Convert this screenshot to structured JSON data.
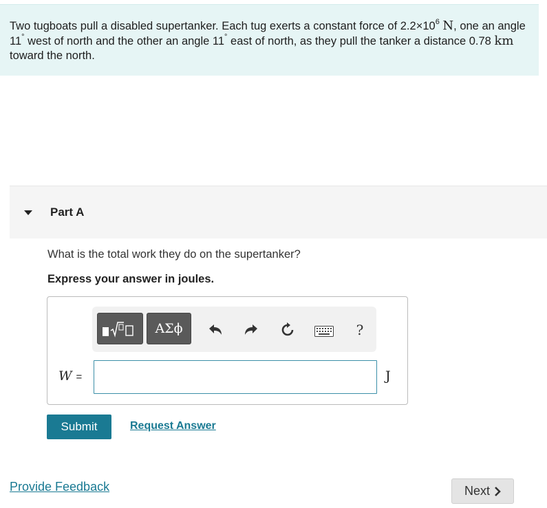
{
  "problem": {
    "text_1": "Two tugboats pull a disabled supertanker. Each tug exerts a constant force of 2.2×10",
    "force_exp": "6",
    "force_unit": "N",
    "text_2": ", one an angle 11",
    "deg_1": "°",
    "text_3": " west of north and the other an angle 11",
    "deg_2": "°",
    "text_4": " east of north, as they pull the tanker a distance 0.78 ",
    "distance_unit": "km",
    "text_5": " toward the north."
  },
  "part": {
    "title": "Part A",
    "question": "What is the total work they do on the supertanker?",
    "instruction": "Express your answer in joules."
  },
  "toolbar": {
    "greek_label": "ΑΣϕ",
    "help_label": "?",
    "icons": [
      "templates-icon",
      "undo-icon",
      "redo-icon",
      "reset-icon",
      "keyboard-icon"
    ]
  },
  "answer": {
    "variable": "W",
    "equals": "=",
    "value": "",
    "unit": "J"
  },
  "actions": {
    "submit_label": "Submit",
    "request_answer_label": "Request Answer",
    "feedback_label": "Provide Feedback",
    "next_label": "Next"
  },
  "colors": {
    "problem_bg": "#e6f5f5",
    "accent": "#1a7a93",
    "toolbar_dark": "#5a5a5a"
  }
}
